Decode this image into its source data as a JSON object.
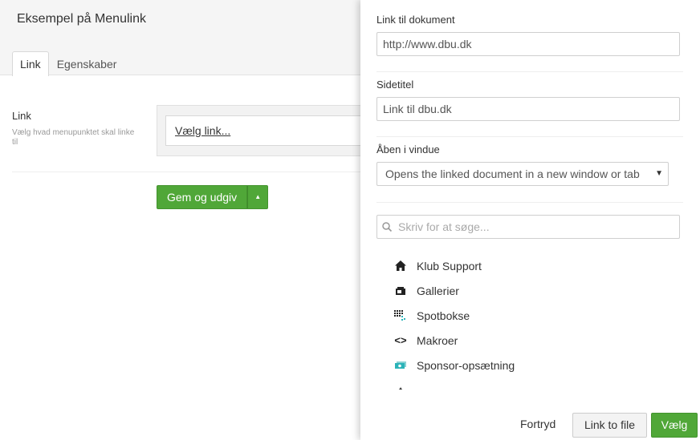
{
  "editor": {
    "title": "Eksempel på Menulink",
    "tabs": [
      {
        "label": "Link",
        "active": true
      },
      {
        "label": "Egenskaber",
        "active": false
      }
    ],
    "property": {
      "label": "Link",
      "description": "Vælg hvad menupunktet skal linke til",
      "picker_link": "Vælg link..."
    },
    "save_button": "Gem og udgiv",
    "accent_color": "#50a738"
  },
  "dialog": {
    "link_field": {
      "label": "Link til dokument",
      "value": "http://www.dbu.dk"
    },
    "title_field": {
      "label": "Sidetitel",
      "value": "Link til dbu.dk"
    },
    "window_field": {
      "label": "Åben i vindue",
      "selected": "Opens the linked document in a new window or tab"
    },
    "search": {
      "placeholder": "Skriv for at søge..."
    },
    "tree": [
      {
        "label": "Klub Support",
        "icon": "home-icon"
      },
      {
        "label": "Gallerier",
        "icon": "gallery-icon"
      },
      {
        "label": "Spotbokse",
        "icon": "grid-icon"
      },
      {
        "label": "Makroer",
        "icon": "code-icon"
      },
      {
        "label": "Sponsor-opsætning",
        "icon": "money-icon"
      }
    ],
    "cancel_label": "Fortryd",
    "file_label": "Link to file",
    "choose_label": "Vælg"
  }
}
